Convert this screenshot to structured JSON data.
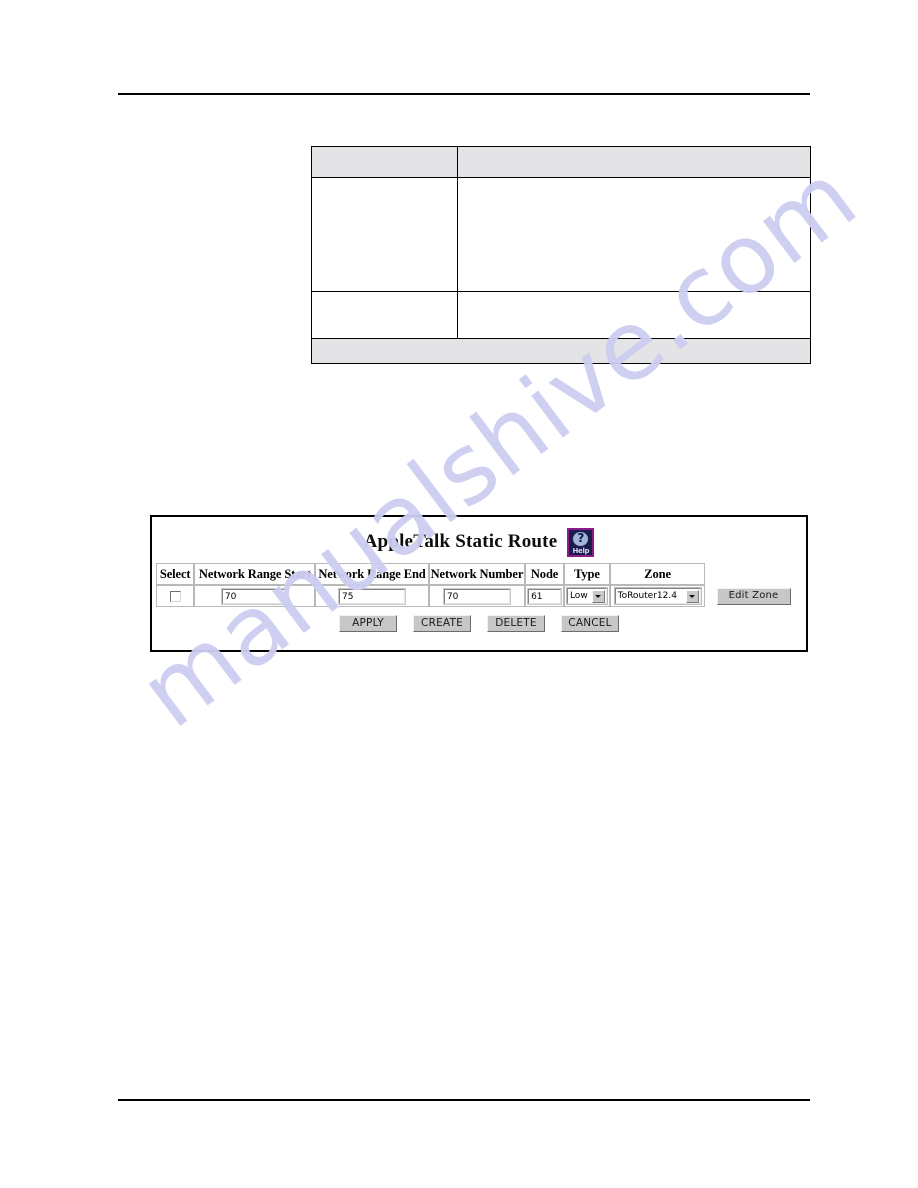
{
  "page": {
    "background": "#ffffff",
    "header_rule": true,
    "footer_rule": true
  },
  "watermark": {
    "text": "manualshive.com",
    "color": "#cdcdf2"
  },
  "doc_table": {
    "columns": 2,
    "rows": [
      {
        "type": "header",
        "shaded": true,
        "cells": [
          "",
          ""
        ]
      },
      {
        "type": "body",
        "shaded": false,
        "cells": [
          "",
          ""
        ]
      },
      {
        "type": "body",
        "shaded": false,
        "cells": [
          "",
          ""
        ]
      },
      {
        "type": "footer",
        "shaded": true,
        "cells": [
          ""
        ]
      }
    ]
  },
  "webui": {
    "title": "AppleTalk Static Route",
    "help_icon": {
      "name": "help-icon",
      "glyph": "?",
      "label": "Help",
      "border_color": "#8d1a8d",
      "fill_color": "#1b1b4d",
      "bubble_color": "#9fb6d8"
    },
    "table": {
      "headers": [
        "Select",
        "Network Range Start",
        "Network Range End",
        "Network Number",
        "Node",
        "Type",
        "Zone",
        ""
      ],
      "row": {
        "select_checked": false,
        "network_range_start": "70",
        "network_range_end": "75",
        "network_number": "70",
        "node": "61",
        "type": "Low",
        "zone": "ToRouter12.4",
        "edit_zone_label": "Edit Zone"
      }
    },
    "buttons": [
      "APPLY",
      "CREATE",
      "DELETE",
      "CANCEL"
    ]
  }
}
